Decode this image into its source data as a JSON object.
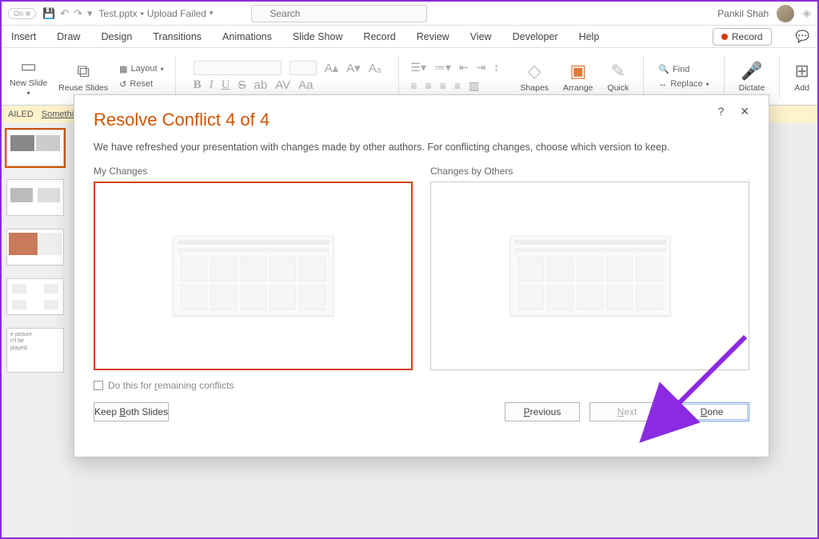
{
  "titlebar": {
    "on_label": "On",
    "doc_name": "Test.pptx",
    "doc_status": "Upload Failed",
    "search_placeholder": "Search",
    "user_name": "Pankil Shah"
  },
  "menubar": {
    "tabs": [
      "Insert",
      "Draw",
      "Design",
      "Transitions",
      "Animations",
      "Slide Show",
      "Record",
      "Review",
      "View",
      "Developer",
      "Help"
    ],
    "record": "Record"
  },
  "ribbon": {
    "new_slide": "New Slide",
    "reuse_slides": "Reuse Slides",
    "layout": "Layout",
    "reset": "Reset",
    "shapes": "Shapes",
    "arrange": "Arrange",
    "quick": "Quick",
    "find": "Find",
    "replace": "Replace",
    "dictate": "Dictate",
    "add": "Add"
  },
  "msgbar": {
    "failed": "AILED",
    "something": "Something",
    "picture": "e picture",
    "nbe": "n't be",
    "played": "played."
  },
  "dialog": {
    "title": "Resolve Conflict 4 of 4",
    "subtitle": "We have refreshed your presentation with changes made by other authors. For conflicting changes, choose which version to keep.",
    "my_changes": "My Changes",
    "others_changes": "Changes by Others",
    "do_remaining_prefix": "Do this for ",
    "do_remaining_key": "r",
    "do_remaining_suffix": "emaining conflicts",
    "keep_both_label": "Keep ",
    "keep_both_key": "B",
    "keep_both_suffix": "oth Slides",
    "prev_key": "P",
    "prev_suffix": "revious",
    "next_key": "N",
    "next_suffix": "ext",
    "done_key": "D",
    "done_suffix": "one"
  }
}
